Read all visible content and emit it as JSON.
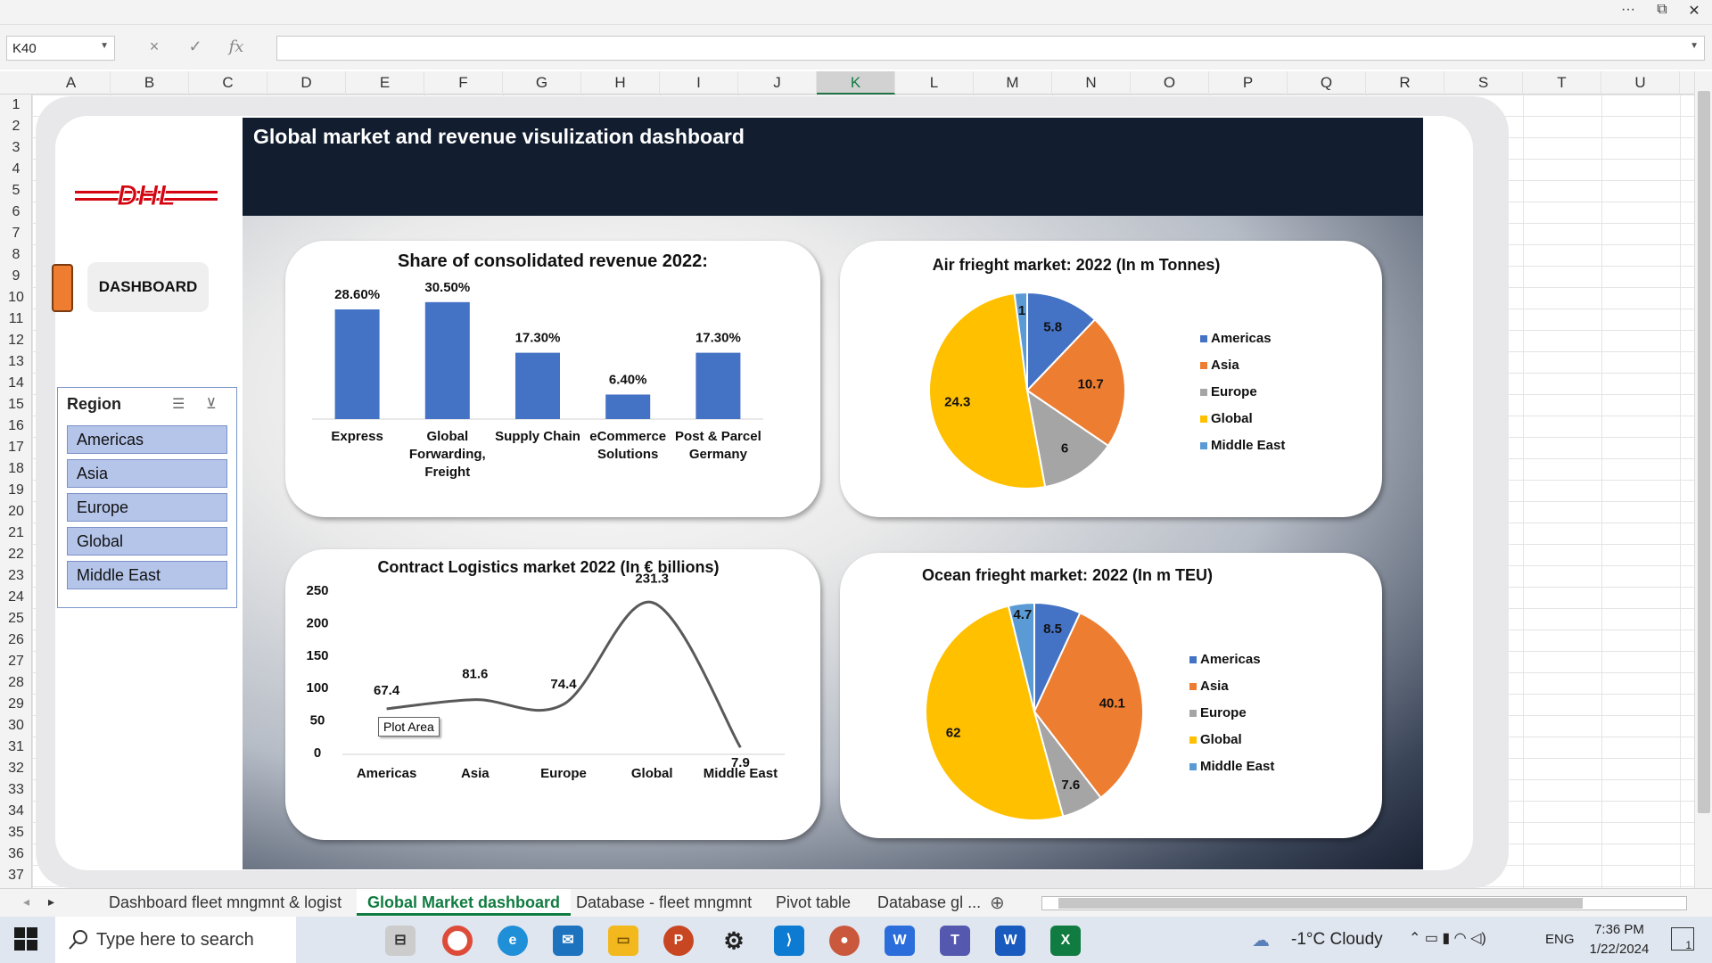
{
  "window": {
    "more_icon": "more-icon",
    "restore_icon": "restore-icon",
    "close_icon": "close-icon"
  },
  "formula_bar": {
    "name_box": "K40",
    "cancel_icon": "×",
    "enter_icon": "✓",
    "fx_label": "fx",
    "value": ""
  },
  "columns": [
    "A",
    "B",
    "C",
    "D",
    "E",
    "F",
    "G",
    "H",
    "I",
    "J",
    "K",
    "L",
    "M",
    "N",
    "O",
    "P",
    "Q",
    "R",
    "S",
    "T",
    "U"
  ],
  "selected_column": "K",
  "rows": [
    "1",
    "2",
    "3",
    "4",
    "5",
    "6",
    "7",
    "8",
    "9",
    "10",
    "11",
    "12",
    "13",
    "14",
    "15",
    "16",
    "17",
    "18",
    "19",
    "20",
    "21",
    "22",
    "23",
    "24",
    "25",
    "26",
    "27",
    "28",
    "29",
    "30",
    "31",
    "32",
    "33",
    "34",
    "35",
    "36",
    "37"
  ],
  "dashboard": {
    "title": "Global market and revenue visulization dashboard",
    "logo_text": "DHL",
    "nav_button": "DASHBOARD",
    "slicer": {
      "title": "Region",
      "items": [
        "Americas",
        "Asia",
        "Europe",
        "Global",
        "Middle East"
      ]
    },
    "tooltip": "Plot Area"
  },
  "colors": {
    "blue": "#4472c4",
    "orange": "#ed7d31",
    "gray": "#a5a5a5",
    "gold": "#ffc000",
    "lightblue": "#5b9bd5",
    "banner": "#121e30"
  },
  "chart_data": [
    {
      "type": "bar",
      "title": "Share of consolidated revenue  2022:",
      "categories": [
        "Express",
        "Global Forwarding, Freight",
        "Supply Chain",
        "eCommerce Solutions",
        "Post & Parcel Germany"
      ],
      "category_lines": [
        [
          "Express"
        ],
        [
          "Global",
          "Forwarding,",
          "Freight"
        ],
        [
          "Supply Chain"
        ],
        [
          "eCommerce",
          "Solutions"
        ],
        [
          "Post & Parcel",
          "Germany"
        ]
      ],
      "values": [
        28.6,
        30.5,
        17.3,
        6.4,
        17.3
      ],
      "labels": [
        "28.60%",
        "30.50%",
        "17.30%",
        "6.40%",
        "17.30%"
      ],
      "ylim": [
        0,
        35
      ],
      "grid": false
    },
    {
      "type": "pie",
      "title": "Air frieght market: 2022 (In m  Tonnes)",
      "categories": [
        "Americas",
        "Asia",
        "Europe",
        "Global",
        "Middle East"
      ],
      "values": [
        5.8,
        10.7,
        6,
        24.3,
        1
      ],
      "labels": [
        "5.8",
        "10.7",
        "6",
        "24.3",
        "1"
      ],
      "legend": "right"
    },
    {
      "type": "line",
      "title": "Contract Logistics market 2022 (In € billions)",
      "categories": [
        "Americas",
        "Asia",
        "Europe",
        "Global",
        "Middle East"
      ],
      "values": [
        67.4,
        81.6,
        74.4,
        231.3,
        7.9
      ],
      "labels": [
        "67.4",
        "81.6",
        "74.4",
        "231.3",
        "7.9"
      ],
      "yticks": [
        "0",
        "50",
        "100",
        "150",
        "200",
        "250"
      ],
      "ylim": [
        0,
        250
      ],
      "smooth": true
    },
    {
      "type": "pie",
      "title": "Ocean frieght market: 2022 (In m TEU)",
      "categories": [
        "Americas",
        "Asia",
        "Europe",
        "Global",
        "Middle East"
      ],
      "values": [
        8.5,
        40.1,
        7.6,
        62,
        4.7
      ],
      "labels": [
        "8.5",
        "40.1",
        "7.6",
        "62",
        "4.7"
      ],
      "legend": "right"
    }
  ],
  "sheet_tabs": [
    "Dashboard fleet mngmnt & logist",
    "Global Market dashboard",
    "Database - fleet mngmnt",
    "Pivot table",
    "Database gl ..."
  ],
  "active_tab": "Global Market dashboard",
  "taskbar": {
    "search_placeholder": "Type here to search",
    "weather": "-1°C  Cloudy",
    "language": "ENG",
    "time": "7:36 PM",
    "date": "1/22/2024",
    "notification_count": "1"
  }
}
